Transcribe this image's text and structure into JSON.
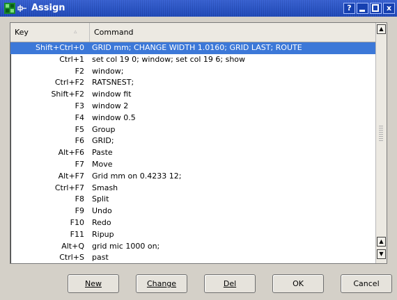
{
  "window": {
    "title": "Assign",
    "controls": {
      "help": "?",
      "minimize": "",
      "maximize": "",
      "close": "x"
    }
  },
  "table": {
    "columns": {
      "key": "Key",
      "command": "Command"
    },
    "sort_indicator": "▵",
    "rows": [
      {
        "key": "Shift+Ctrl+0",
        "command": "GRID mm; CHANGE WIDTH 1.0160; GRID LAST; ROUTE",
        "selected": true
      },
      {
        "key": "Ctrl+1",
        "command": "set col 19 0; window; set col 19 6; show"
      },
      {
        "key": "F2",
        "command": "window;"
      },
      {
        "key": "Ctrl+F2",
        "command": "RATSNEST;"
      },
      {
        "key": "Shift+F2",
        "command": "window fit"
      },
      {
        "key": "F3",
        "command": "window 2"
      },
      {
        "key": "F4",
        "command": "window 0.5"
      },
      {
        "key": "F5",
        "command": "Group"
      },
      {
        "key": "F6",
        "command": "GRID;"
      },
      {
        "key": "Alt+F6",
        "command": "Paste"
      },
      {
        "key": "F7",
        "command": "Move"
      },
      {
        "key": "Alt+F7",
        "command": "Grid mm on 0.4233 12;"
      },
      {
        "key": "Ctrl+F7",
        "command": "Smash"
      },
      {
        "key": "F8",
        "command": "Split"
      },
      {
        "key": "F9",
        "command": "Undo"
      },
      {
        "key": "F10",
        "command": "Redo"
      },
      {
        "key": "F11",
        "command": "Ripup"
      },
      {
        "key": "Alt+Q",
        "command": "grid mic 1000 on;"
      },
      {
        "key": "Ctrl+S",
        "command": "past"
      }
    ]
  },
  "scrollbar": {
    "up_glyph": "▲",
    "down_glyph": "▼"
  },
  "buttons": {
    "new": "New",
    "change": "Change",
    "del": "Del",
    "ok": "OK",
    "cancel": "Cancel"
  }
}
